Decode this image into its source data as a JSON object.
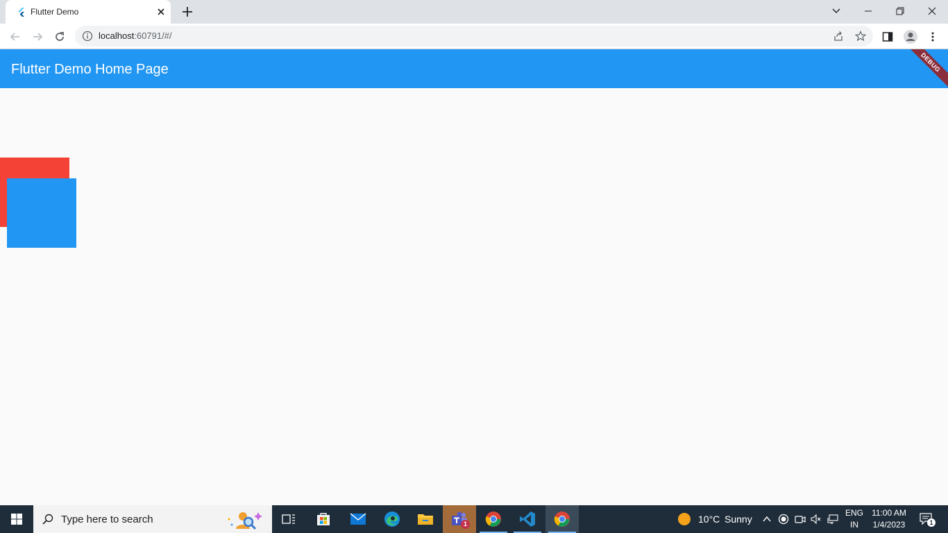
{
  "browser": {
    "tab": {
      "title": "Flutter Demo"
    },
    "url": {
      "host": "localhost",
      "rest": ":60791/#/"
    }
  },
  "app": {
    "title": "Flutter Demo Home Page",
    "debug_banner": "DEBUG",
    "colors": {
      "appbar": "#2196f3",
      "red_box": "#f44336",
      "blue_box": "#2196f3"
    }
  },
  "taskbar": {
    "search_placeholder": "Type here to search",
    "teams_badge": "1",
    "weather": {
      "temp": "10°C",
      "condition": "Sunny"
    },
    "language": {
      "line1": "ENG",
      "line2": "IN"
    },
    "clock": {
      "time": "11:00 AM",
      "date": "1/4/2023"
    },
    "notification_count": "1"
  }
}
